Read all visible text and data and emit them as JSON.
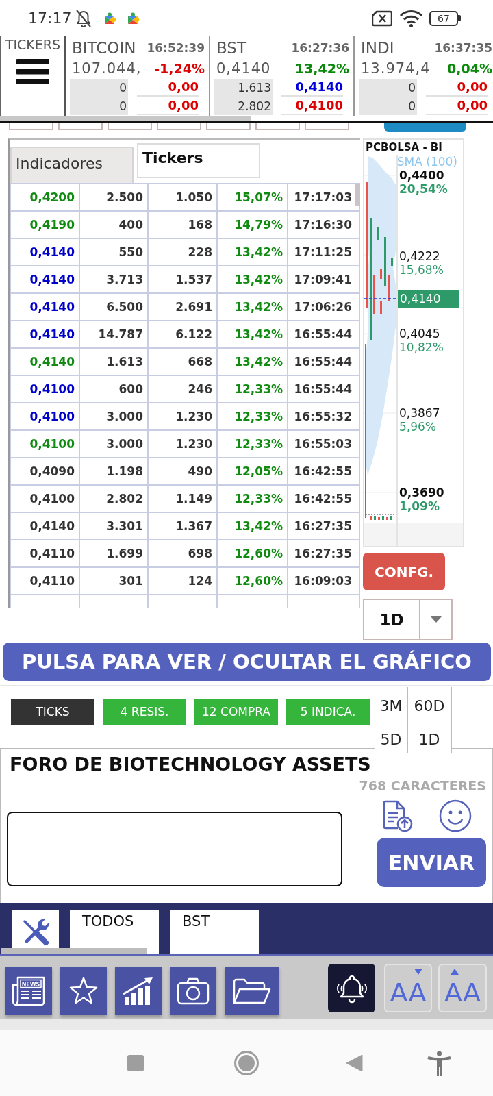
{
  "status_bar": {
    "time": "17:17",
    "battery": "67"
  },
  "ticker_strip": {
    "label": "TICKERS",
    "tickers": [
      {
        "name": "BITCOIN",
        "time": "16:52:39",
        "price": "107.044,",
        "change": {
          "text": "-1,24%",
          "color": "#dd0000"
        },
        "rows": [
          {
            "quantity": "0",
            "value": "0,00",
            "color": "#dd0000"
          },
          {
            "quantity": "0",
            "value": "0,00",
            "color": "#dd0000"
          }
        ]
      },
      {
        "name": "BST",
        "time": "16:27:36",
        "price": "0,4140",
        "change": {
          "text": "13,42%",
          "color": "#0a880a"
        },
        "rows": [
          {
            "quantity": "1.613",
            "value": "0,4140",
            "color": "#0000dd"
          },
          {
            "quantity": "2.802",
            "value": "0,4100",
            "color": "#dd0000"
          }
        ]
      },
      {
        "name": "INDI",
        "time": "16:37:35",
        "price": "13.974,4",
        "change": {
          "text": "0,04%",
          "color": "#0a880a"
        },
        "rows": [
          {
            "quantity": "0",
            "value": "0,00",
            "color": "#dd0000"
          },
          {
            "quantity": "0",
            "value": "0,00",
            "color": "#dd0000"
          }
        ]
      }
    ]
  },
  "panel_tabs": [
    {
      "label": "Indicadores",
      "selected": false
    },
    {
      "label": "Tickers",
      "selected": true
    }
  ],
  "trades": [
    {
      "cells": [
        "0,4200",
        "2.500",
        "1.050",
        "15,07%",
        "17:17:03"
      ],
      "color": "#108a10"
    },
    {
      "cells": [
        "0,4190",
        "400",
        "168",
        "14,79%",
        "17:16:30"
      ],
      "color": "#108a10"
    },
    {
      "cells": [
        "0,4140",
        "550",
        "228",
        "13,42%",
        "17:11:25"
      ],
      "color": "#0000cc"
    },
    {
      "cells": [
        "0,4140",
        "3.713",
        "1.537",
        "13,42%",
        "17:09:41"
      ],
      "color": "#0000cc"
    },
    {
      "cells": [
        "0,4140",
        "6.500",
        "2.691",
        "13,42%",
        "17:06:26"
      ],
      "color": "#0000cc"
    },
    {
      "cells": [
        "0,4140",
        "14.787",
        "6.122",
        "13,42%",
        "16:55:44"
      ],
      "color": "#0000cc"
    },
    {
      "cells": [
        "0,4140",
        "1.613",
        "668",
        "13,42%",
        "16:55:44"
      ],
      "color": "#108a10"
    },
    {
      "cells": [
        "0,4100",
        "600",
        "246",
        "12,33%",
        "16:55:44"
      ],
      "color": "#0000cc"
    },
    {
      "cells": [
        "0,4100",
        "3.000",
        "1.230",
        "12,33%",
        "16:55:32"
      ],
      "color": "#0000cc"
    },
    {
      "cells": [
        "0,4100",
        "3.000",
        "1.230",
        "12,33%",
        "16:55:03"
      ],
      "color": "#108a10"
    },
    {
      "cells": [
        "0,4090",
        "1.198",
        "490",
        "12,05%",
        "16:42:55"
      ],
      "color": "#333333"
    },
    {
      "cells": [
        "0,4100",
        "2.802",
        "1.149",
        "12,33%",
        "16:42:55"
      ],
      "color": "#333333"
    },
    {
      "cells": [
        "0,4140",
        "3.301",
        "1.367",
        "13,42%",
        "16:27:35"
      ],
      "color": "#333333"
    },
    {
      "cells": [
        "0,4110",
        "1.699",
        "698",
        "12,60%",
        "16:27:35"
      ],
      "color": "#333333"
    },
    {
      "cells": [
        "0,4110",
        "301",
        "124",
        "12,60%",
        "16:09:03"
      ],
      "color": "#333333"
    }
  ],
  "chart": {
    "title": "PCBOLSA - BI",
    "legend": "SMA (100)",
    "axis_labels": [
      {
        "price": "0,4400",
        "change": "20,54%",
        "kind": "bound"
      },
      {
        "price": "0,4222",
        "change": "15,68%",
        "kind": "level"
      },
      {
        "price": "0,4045",
        "change": "10,82%",
        "kind": "level"
      },
      {
        "price": "0,3867",
        "change": "5,96%",
        "kind": "level"
      },
      {
        "price": "0,3690",
        "change": "1,09%",
        "kind": "bound"
      }
    ],
    "last_price": "0,4140"
  },
  "config_button": "CONFG.",
  "period_select": {
    "value": "1D"
  },
  "toggle_chart_button": "PULSA PARA VER / OCULTAR EL GRÁFICO",
  "filter_chips": [
    {
      "label": "TICKS",
      "selected": true
    },
    {
      "label": "4 RESIS.",
      "selected": false
    },
    {
      "label": "12 COMPRA",
      "selected": false
    },
    {
      "label": "5 INDICA.",
      "selected": false
    }
  ],
  "period_options": [
    {
      "label": "3M"
    },
    {
      "label": "60D"
    },
    {
      "label": "5D"
    },
    {
      "label": "1D"
    }
  ],
  "forum": {
    "title": "FORO DE BIOTECHNOLOGY ASSETS",
    "char_count": "768 CARACTERES",
    "send_button": "ENVIAR"
  },
  "forum_tabs": [
    {
      "label": "TODOS"
    },
    {
      "label": "BST"
    }
  ],
  "toolbar": {
    "news_icon_text": "NEWS",
    "font_buttons": [
      {
        "label": "AA",
        "kind": "decrease"
      },
      {
        "label": "AA",
        "kind": "increase"
      }
    ]
  }
}
